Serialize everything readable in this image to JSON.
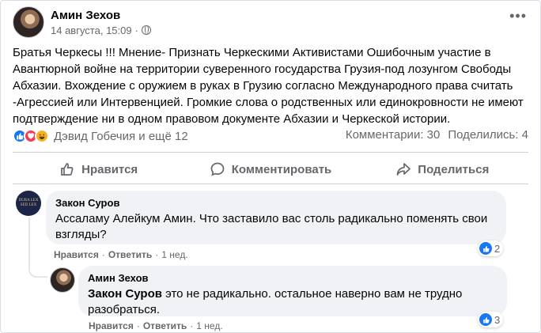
{
  "post": {
    "author": "Амин Зехов",
    "date": "14 августа, 15:09",
    "privacy_separator": "·",
    "more_icon": "•••",
    "text": "Братья Черкесы !!! Мнение- Признать Черкескими Активистами Ошибочным участие в Авантюрной войне  на территории суверенного государства Грузия-под лозунгом Свободы Абхазии. Вхождение с оружием в руках в Грузию согласно Международного права считать -Агрессией или Интервенцией. Громкие слова о родственных или единокровности не имеют подтверждение ни в одном правовом документе Абхазии и Черкеской истории.",
    "reactions": {
      "icons": [
        "like-icon",
        "love-icon",
        "haha-icon"
      ],
      "names": "Дэвид Гобечия и ещё 12"
    },
    "comments_count": "Комментарии: 30",
    "shares_count": "Поделились: 4"
  },
  "actions": {
    "like": "Нравится",
    "comment": "Комментировать",
    "share": "Поделиться"
  },
  "comments": [
    {
      "avatar_text": [
        "DURA LEX",
        "SED LEX"
      ],
      "author": "Закон Суров",
      "text": "Ассаламу Алейкум Амин. Что заставило вас столь радикально поменять свои взгляды?",
      "like_label": "Нравится",
      "reply_label": "Ответить",
      "time": "1 нед.",
      "reaction_count": "2"
    },
    {
      "author": "Амин Зехов",
      "mention": "Закон Суров",
      "text": " это не радикально. остальное наверно вам не трудно разобраться.",
      "like_label": "Нравится",
      "reply_label": "Ответить",
      "time": "1 нед.",
      "reaction_count": "3"
    }
  ],
  "colors": {
    "link_blue": "#1877f2",
    "secondary_text": "#65676b",
    "bubble_bg": "#f0f2f5"
  }
}
